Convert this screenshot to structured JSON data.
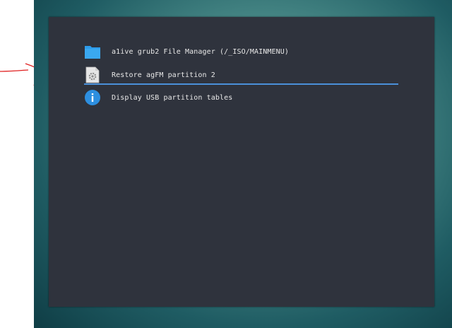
{
  "menu": {
    "items": [
      {
        "label": "a1ive grub2 File Manager (/_ISO/MAINMENU)",
        "icon": "folder-icon"
      },
      {
        "label": "Restore agFM partition 2",
        "icon": "settings-file-icon"
      },
      {
        "label": "Display USB partition tables",
        "icon": "info-icon"
      }
    ],
    "selected_index": 1
  },
  "colors": {
    "panel": "#2f333d",
    "selection": "#4a90d9",
    "folder": "#2d9ceb",
    "info": "#2d8fe0",
    "annotation": "#e02020"
  }
}
